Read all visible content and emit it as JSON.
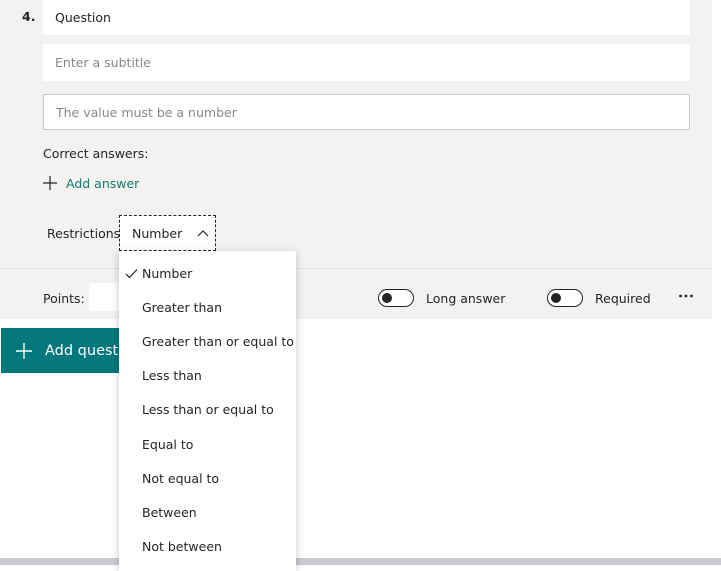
{
  "question": {
    "number": "4.",
    "title": "Question",
    "subtitle_placeholder": "Enter a subtitle",
    "value_placeholder": "The value must be a number",
    "correct_answers_label": "Correct answers:",
    "add_answer_label": "Add answer",
    "restrictions_label": "Restrictions",
    "restriction_selected": "Number"
  },
  "footer": {
    "points_label": "Points:",
    "long_answer_label": "Long answer",
    "required_label": "Required",
    "more_icon": "more-icon"
  },
  "add_question_label": "Add question",
  "dropdown": {
    "options": [
      {
        "label": "Number",
        "selected": true
      },
      {
        "label": "Greater than",
        "selected": false
      },
      {
        "label": "Greater than or equal to",
        "selected": false
      },
      {
        "label": "Less than",
        "selected": false
      },
      {
        "label": "Less than or equal to",
        "selected": false
      },
      {
        "label": "Equal to",
        "selected": false
      },
      {
        "label": "Not equal to",
        "selected": false
      },
      {
        "label": "Between",
        "selected": false
      },
      {
        "label": "Not between",
        "selected": false
      }
    ]
  },
  "colors": {
    "accent": "#03787c",
    "link": "#0f7b6c",
    "card_bg": "#f3f2f1"
  }
}
